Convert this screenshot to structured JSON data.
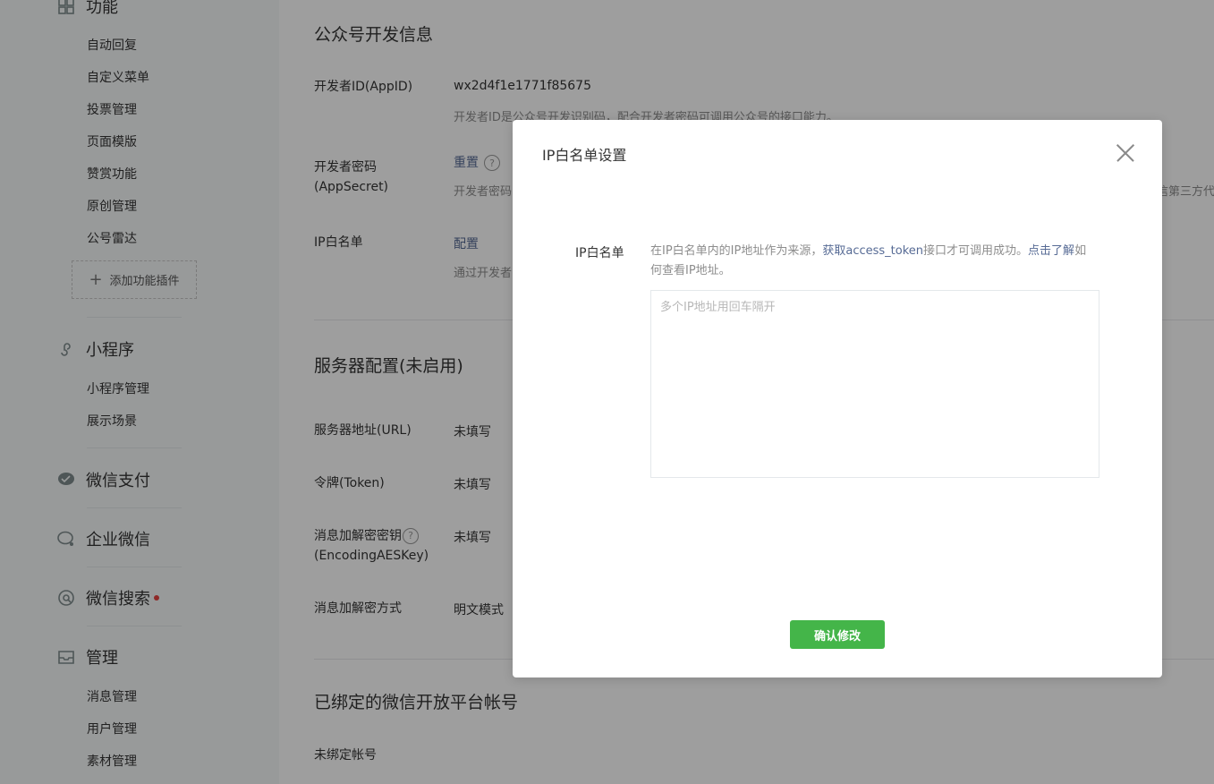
{
  "sidebar": {
    "feature_head": "功能",
    "feature_items": [
      "自动回复",
      "自定义菜单",
      "投票管理",
      "页面模版",
      "赞赏功能",
      "原创管理",
      "公号雷达"
    ],
    "add_plugin": "添加功能插件",
    "miniprogram_head": "小程序",
    "miniprogram_items": [
      "小程序管理",
      "展示场景"
    ],
    "pay_head": "微信支付",
    "work_head": "企业微信",
    "search_head": "微信搜索",
    "manage_head": "管理",
    "manage_items": [
      "消息管理",
      "用户管理",
      "素材管理"
    ]
  },
  "main": {
    "dev_info_title": "公众号开发信息",
    "appid_label": "开发者ID(AppID)",
    "appid_value": "wx2d4f1e1771f85675",
    "appid_desc": "开发者ID是公众号开发识别码，配合开发者密码可调用公众号的接口能力。",
    "secret_label_1": "开发者密码",
    "secret_label_2": "(AppSecret)",
    "secret_reset": "重置",
    "secret_desc": "开发者密码",
    "secret_desc_right": "信第三方代",
    "ip_label": "IP白名单",
    "ip_config": "配置",
    "ip_desc": "通过开发者",
    "server_title": "服务器配置(未启用)",
    "url_label": "服务器地址(URL)",
    "url_value": "未填写",
    "token_label": "令牌(Token)",
    "token_value": "未填写",
    "aes_label_1": "消息加解密密钥",
    "aes_label_2": "(EncodingAESKey)",
    "aes_value": "未填写",
    "mode_label": "消息加解密方式",
    "mode_value": "明文模式",
    "bound_title": "已绑定的微信开放平台帐号",
    "bound_value": "未绑定帐号"
  },
  "dialog": {
    "title": "IP白名单设置",
    "field_label": "IP白名单",
    "tip_part1": "在IP白名单内的IP地址作为来源，",
    "tip_link1": "获取access_token",
    "tip_part2": "接口才可调用成功。",
    "tip_link2": "点击了解",
    "tip_part3": "如何查看IP地址。",
    "textarea_placeholder": "多个IP地址用回车隔开",
    "textarea_value": "",
    "confirm_label": "确认修改"
  },
  "colors": {
    "brand_green": "#44b549",
    "link_blue": "#576b95",
    "badge_red": "#e64340",
    "overlay": "rgba(0,0,0,0.38)"
  }
}
